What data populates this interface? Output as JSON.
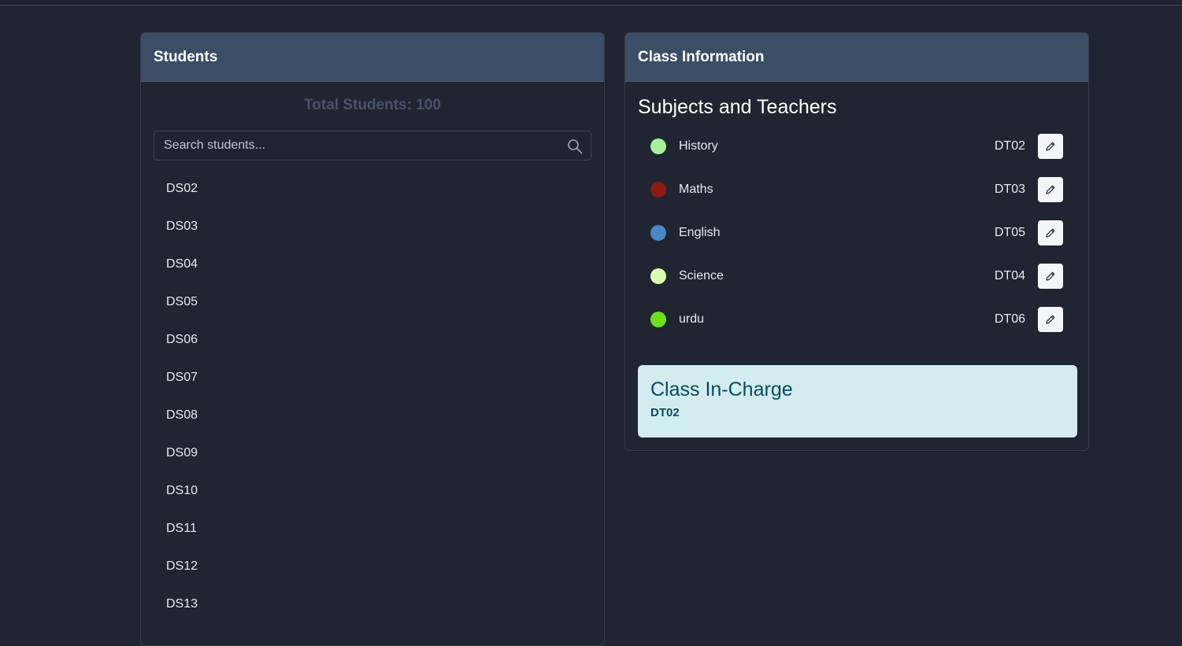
{
  "students_panel": {
    "title": "Students",
    "total_label": "Total Students: 100",
    "search_placeholder": "Search students...",
    "students": [
      "DS02",
      "DS03",
      "DS04",
      "DS05",
      "DS06",
      "DS07",
      "DS08",
      "DS09",
      "DS10",
      "DS11",
      "DS12",
      "DS13"
    ]
  },
  "class_panel": {
    "title": "Class Information",
    "section_title": "Subjects and Teachers",
    "subjects": [
      {
        "name": "History",
        "teacher": "DT02",
        "color": "#a4f29c"
      },
      {
        "name": "Maths",
        "teacher": "DT03",
        "color": "#8b1c12"
      },
      {
        "name": "English",
        "teacher": "DT05",
        "color": "#4a86c8"
      },
      {
        "name": "Science",
        "teacher": "DT04",
        "color": "#dcfbb0"
      },
      {
        "name": "urdu",
        "teacher": "DT06",
        "color": "#6ee11a"
      }
    ],
    "in_charge": {
      "title": "Class In-Charge",
      "value": "DT02"
    }
  }
}
